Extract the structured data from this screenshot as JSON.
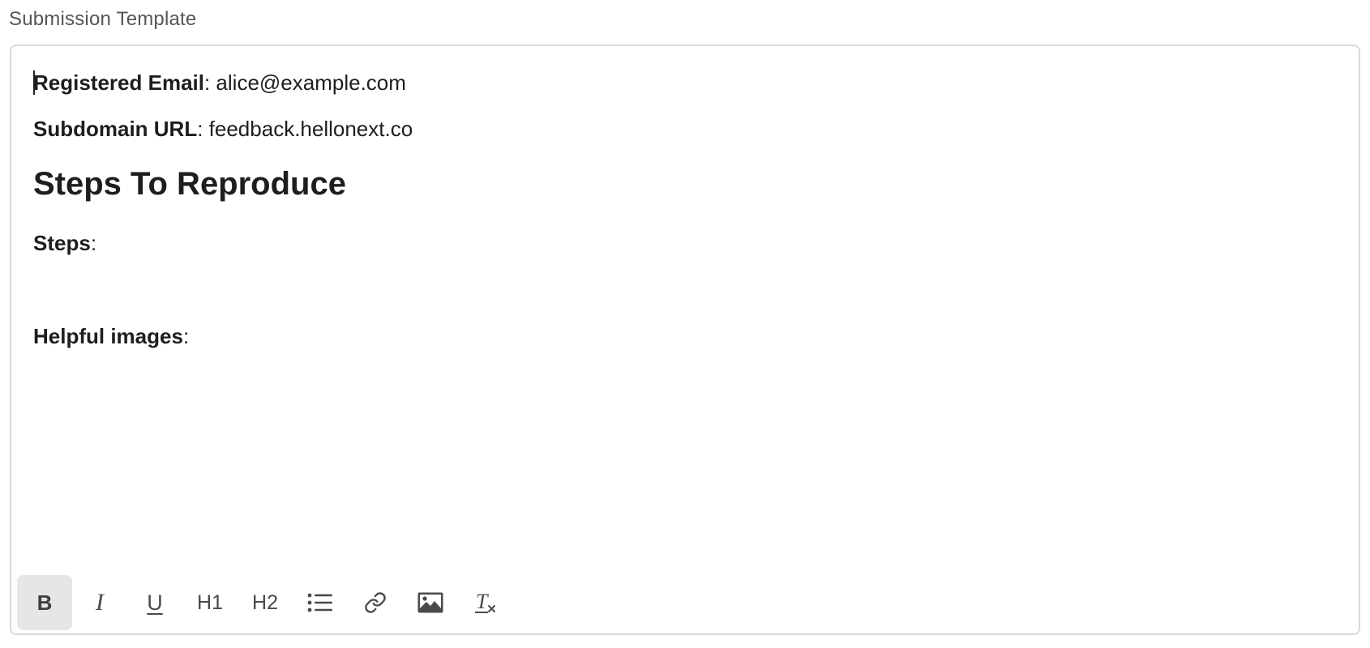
{
  "field": {
    "label": "Submission Template"
  },
  "content": {
    "email": {
      "label": "Registered Email",
      "value": ": alice@example.com"
    },
    "subdomain": {
      "label": "Subdomain URL",
      "value": ": feedback.hellonext.co"
    },
    "heading": "Steps To Reproduce",
    "steps": {
      "label": "Steps",
      "value": ":"
    },
    "images": {
      "label": "Helpful images",
      "value": ":"
    }
  },
  "toolbar": {
    "bold_label": "B",
    "italic_label": "I",
    "underline_label": "U",
    "h1_label": "H1",
    "h2_label": "H2",
    "active": "bold",
    "icons": [
      "bulleted-list-icon",
      "link-icon",
      "image-icon",
      "clear-format-icon"
    ]
  }
}
